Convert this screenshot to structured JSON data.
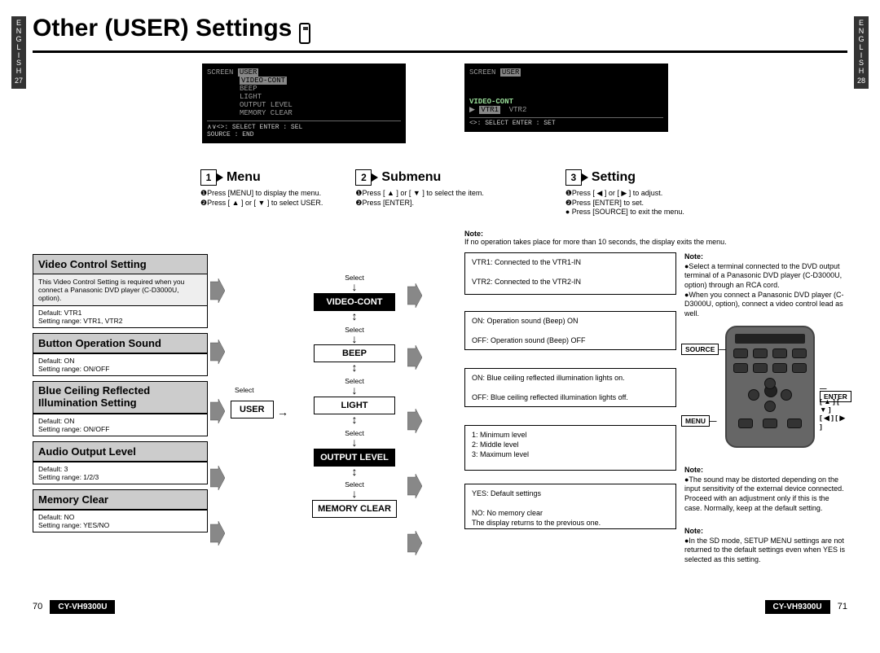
{
  "lang_left": "E\nN\nG\nL\nI\nS\nH",
  "lang_right": "E\nN\nG\nL\nI\nS\nH",
  "page_left_num": "27",
  "page_right_num": "28",
  "title": "Other (USER) Settings",
  "screen_left": {
    "line1": "SCREEN",
    "line1b": "USER",
    "line2": "VIDEO-CONT",
    "line3": "BEEP",
    "line4": "LIGHT",
    "line5": "OUTPUT LEVEL",
    "line6": "MEMORY CLEAR",
    "caption": "∧∨<>: SELECT   ENTER : SEL\nSOURCE : END"
  },
  "screen_right": {
    "line1": "SCREEN",
    "line1b": "USER",
    "vlabel": "VIDEO-CONT",
    "v1": "VTR1",
    "v2": "VTR2",
    "caption": "<>: SELECT   ENTER : SET"
  },
  "sections": {
    "menu": {
      "num": "1",
      "title": "Menu",
      "body": "❶Press [MENU] to display the menu.\n❷Press [ ▲ ] or [ ▼ ] to select USER."
    },
    "submenu": {
      "num": "2",
      "title": "Submenu",
      "body": "❶Press [ ▲ ] or [ ▼ ] to select the item.\n❷Press [ENTER]."
    },
    "setting": {
      "num": "3",
      "title": "Setting",
      "body": "❶Press [ ◀ ] or [ ▶ ] to adjust.\n❷Press [ENTER] to set.\n● Press [SOURCE] to exit the menu."
    },
    "note_label": "Note:",
    "note": "If no operation takes place for more than 10 seconds, the display exits the menu."
  },
  "settings": {
    "video": {
      "title": "Video Control Setting",
      "desc": "This Video Control Setting is required when you connect a Panasonic DVD player (C-D3000U, option).",
      "meta": "Default: VTR1\nSetting range: VTR1, VTR2"
    },
    "beep": {
      "title": "Button Operation Sound",
      "meta": "Default: ON\nSetting range: ON/OFF"
    },
    "light": {
      "title": "Blue Ceiling Reﬂected Illumination Setting",
      "meta": "Default: ON\nSetting range: ON/OFF"
    },
    "output": {
      "title": "Audio Output Level",
      "meta": "Default: 3\nSetting range: 1/2/3"
    },
    "memory": {
      "title": "Memory Clear",
      "meta": "Default: NO\nSetting range: YES/NO"
    }
  },
  "flow": {
    "select": "Select",
    "user": "USER",
    "video": "VIDEO-CONT",
    "beep": "BEEP",
    "light": "LIGHT",
    "output": "OUTPUT LEVEL",
    "memory": "MEMORY CLEAR"
  },
  "details": {
    "video": "VTR1: Connected to the VTR1-IN\n\nVTR2: Connected to the VTR2-IN",
    "beep": "ON:  Operation sound (Beep) ON\n\nOFF: Operation sound (Beep) OFF",
    "light": "ON:  Blue ceiling reﬂected illumination lights on.\n\nOFF: Blue ceiling reﬂected illumination lights off.",
    "output": "1: Minimum level\n2: Middle level\n3: Maximum level",
    "memory": "YES: Default settings\n\nNO: No memory clear\n   The display returns to the previous one."
  },
  "right_notes": {
    "n1_title": "Note:",
    "n1": "●Select a terminal connected to the DVD output terminal of a Panasonic DVD player (C-D3000U, option) through an RCA cord.\n●When you connect a Panasonic DVD player (C-D3000U, option), connect a video control lead as well.",
    "source": "SOURCE",
    "enter": "ENTER",
    "menu": "MENU",
    "brackets": "[ ▲ ] [ ▼ ]\n[ ◀ ] [ ▶ ]",
    "n2_title": "Note:",
    "n2": "●The sound may be distorted depending on the input sensitivity of the external device connected. Proceed with an adjustment only if this is the case. Normally, keep at the default setting.",
    "n3_title": "Note:",
    "n3": "●In the SD mode, SETUP MENU settings are not returned to the default settings even when YES is selected as this setting."
  },
  "footer": {
    "pl": "70",
    "pr": "71",
    "model": "CY-VH9300U"
  }
}
